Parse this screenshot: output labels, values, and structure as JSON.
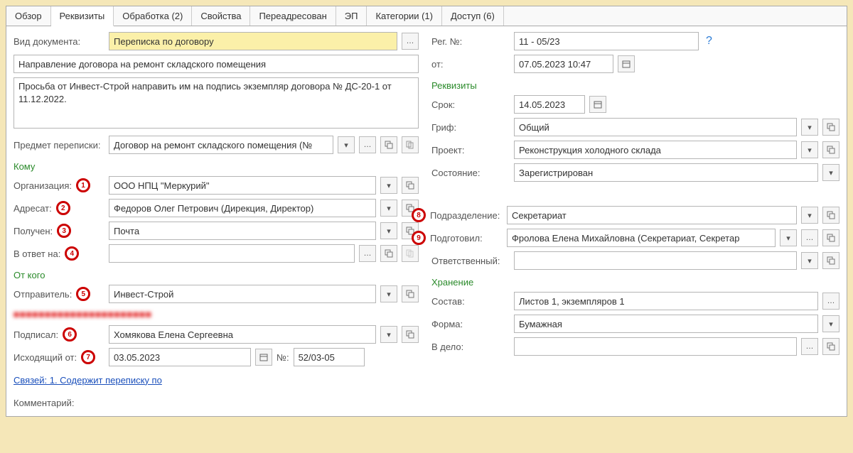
{
  "tabs": {
    "overview": "Обзор",
    "details": "Реквизиты",
    "processing": "Обработка (2)",
    "properties": "Свойства",
    "forwarded": "Переадресован",
    "signature": "ЭП",
    "categories": "Категории (1)",
    "access": "Доступ (6)"
  },
  "left": {
    "doc_type_label": "Вид документа:",
    "doc_type": "Переписка по договору",
    "title": "Направление договора на ремонт складского помещения",
    "description": "Просьба от Инвест-Строй направить им на подпись экземпляр договора № ДС-20-1 от 11.12.2022.",
    "subject_label": "Предмет переписки:",
    "subject": "Договор на ремонт складского помещения (№",
    "to_section": "Кому",
    "org_label": "Организация:",
    "org": "ООО НПЦ \"Меркурий\"",
    "addressee_label": "Адресат:",
    "addressee": "Федоров Олег Петрович (Дирекция, Директор)",
    "received_label": "Получен:",
    "received": "Почта",
    "reply_to_label": "В ответ на:",
    "reply_to": "",
    "from_section": "От кого",
    "sender_label": "Отправитель:",
    "sender": "Инвест-Строй",
    "blurred": "■■■■■■■■■■■■■■■■■■■■■■",
    "signed_label": "Подписал:",
    "signed": "Хомякова Елена Сергеевна",
    "out_date_label": "Исходящий от:",
    "out_date": "03.05.2023",
    "out_no_label": "№:",
    "out_no": "52/03-05",
    "links": "Связей: 1. Содержит переписку по",
    "comment_label": "Комментарий:"
  },
  "right": {
    "regno_label": "Рег. №:",
    "regno": "11 - 05/23",
    "from_label": "от:",
    "from": "07.05.2023 10:47",
    "details_section": "Реквизиты",
    "deadline_label": "Срок:",
    "deadline": "14.05.2023",
    "grif_label": "Гриф:",
    "grif": "Общий",
    "project_label": "Проект:",
    "project": "Реконструкция холодного склада",
    "state_label": "Состояние:",
    "state": "Зарегистрирован",
    "dept_label": "Подразделение:",
    "dept": "Секретариат",
    "prepared_label": "Подготовил:",
    "prepared": "Фролова Елена Михайловна (Секретариат, Секретар",
    "responsible_label": "Ответственный:",
    "responsible": "",
    "storage_section": "Хранение",
    "composition_label": "Состав:",
    "composition": "Листов 1, экземпляров 1",
    "form_label": "Форма:",
    "form": "Бумажная",
    "tofile_label": "В дело:",
    "tofile": ""
  },
  "markers": {
    "m1": "1",
    "m2": "2",
    "m3": "3",
    "m4": "4",
    "m5": "5",
    "m6": "6",
    "m7": "7",
    "m8": "8",
    "m9": "9"
  }
}
